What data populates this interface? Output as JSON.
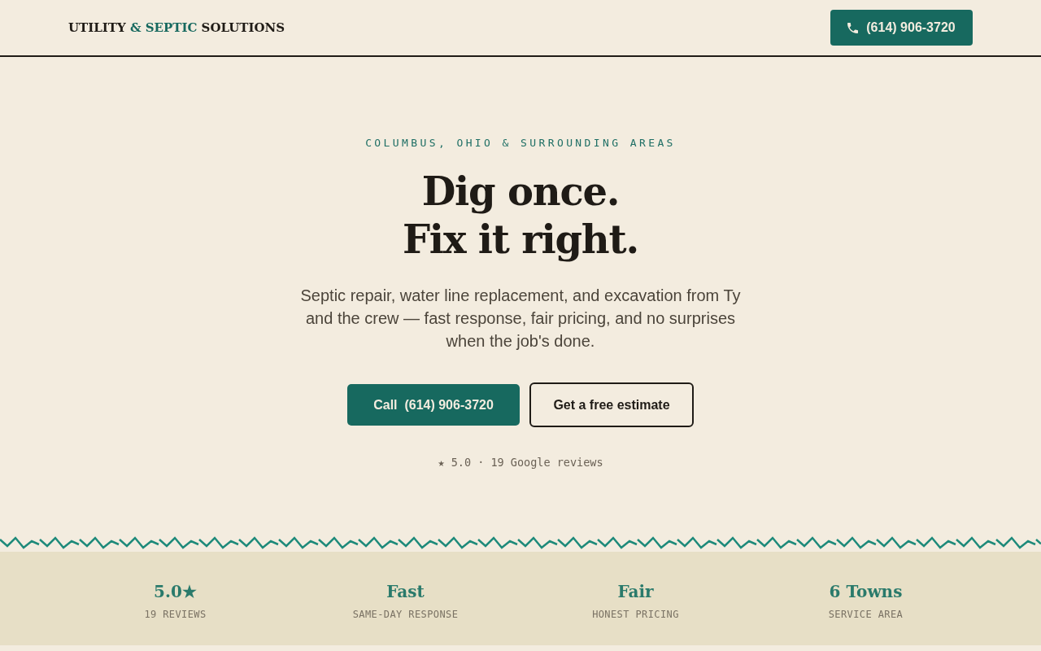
{
  "header": {
    "logo": [
      {
        "text": "UTILITY",
        "accent": false
      },
      {
        "text": "& SEPTIC",
        "accent": true
      },
      {
        "text": "SOLUTIONS",
        "accent": false
      }
    ],
    "phone": "(614) 906-3720"
  },
  "hero": {
    "eyebrow": "COLUMBUS, OHIO & SURROUNDING AREAS",
    "headline": [
      "Dig once.",
      "Fix it right."
    ],
    "lead": "Septic repair, water line replacement, and excavation from Ty and the crew — fast response, fair pricing, and no surprises when the job's done.",
    "buttons": [
      {
        "label": "Call  (614) 906-3720",
        "kind": "primary"
      },
      {
        "label": "Get a free estimate",
        "kind": "outline"
      }
    ],
    "rating": "★ 5.0 · 19 Google reviews"
  },
  "stats": [
    {
      "value": "5.0★",
      "label": "19 REVIEWS"
    },
    {
      "value": "Fast",
      "label": "SAME-DAY RESPONSE"
    },
    {
      "value": "Fair",
      "label": "HONEST PRICING"
    },
    {
      "value": "6 Towns",
      "label": "SERVICE AREA"
    }
  ]
}
